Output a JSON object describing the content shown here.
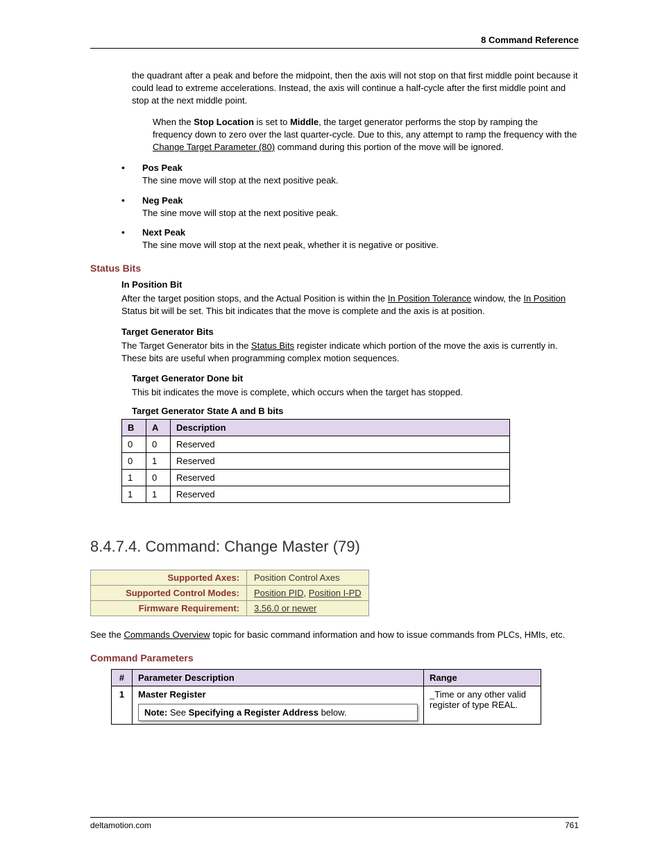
{
  "header": {
    "title": "8  Command Reference"
  },
  "intro_para": "the quadrant after a peak and before the midpoint, then the axis will not stop on that first middle point because it could lead to extreme accelerations. Instead, the axis will continue a half-cycle after the first middle point and stop at the next middle point.",
  "indented": {
    "prefix": "When the ",
    "bold1": "Stop Location",
    "mid1": " is set to ",
    "bold2": "Middle",
    "mid2": ", the target generator performs the stop by ramping the frequency down to zero over the last quarter-cycle. Due to this, any attempt to ramp the frequency with the ",
    "link": "Change Target Parameter (80)",
    "suffix": " command during this portion of the move will be ignored."
  },
  "bullets": [
    {
      "title": "Pos Peak",
      "text": "The sine move will stop at the next positive peak."
    },
    {
      "title": "Neg Peak",
      "text": "The sine move will stop at the next positive peak."
    },
    {
      "title": "Next Peak",
      "text": "The sine move will stop at the next peak, whether it is negative or positive."
    }
  ],
  "status_heading": "Status Bits",
  "in_position": {
    "title": "In Position Bit",
    "p1a": "After the target position stops, and the Actual Position is within the ",
    "link1": "In Position Tolerance",
    "p1b": " window, the ",
    "link2": "In Position",
    "p1c": " Status bit will be set. This bit indicates that the move is complete and the axis is at position."
  },
  "tg_bits": {
    "title": "Target Generator Bits",
    "p_a": "The Target Generator bits in the ",
    "link": "Status Bits",
    "p_b": " register indicate which portion of the move the axis is currently in. These bits are useful when programming complex motion sequences."
  },
  "tg_done": {
    "title": "Target Generator Done bit",
    "text": "This bit indicates the move is complete, which occurs when the target has stopped."
  },
  "tg_state": {
    "title": "Target Generator State A and B bits",
    "headers": [
      "B",
      "A",
      "Description"
    ],
    "rows": [
      [
        "0",
        "0",
        "Reserved"
      ],
      [
        "0",
        "1",
        "Reserved"
      ],
      [
        "1",
        "0",
        "Reserved"
      ],
      [
        "1",
        "1",
        "Reserved"
      ]
    ]
  },
  "section_heading": "8.4.7.4. Command: Change Master (79)",
  "support": {
    "rows": [
      {
        "label": "Supported Axes:",
        "value": "Position Control Axes",
        "linked": false
      },
      {
        "label": "Supported Control Modes:",
        "link1": "Position PID",
        "sep": ", ",
        "link2": "Position I-PD",
        "linked": true
      },
      {
        "label": "Firmware Requirement:",
        "value": "3.56.0 or newer",
        "linked_single": true
      }
    ]
  },
  "overview": {
    "p_a": "See the ",
    "link": "Commands Overview",
    "p_b": " topic for basic command information and how to issue commands from PLCs, HMIs, etc."
  },
  "cmd_params_heading": "Command Parameters",
  "param_table": {
    "headers": [
      "#",
      "Parameter Description",
      "Range"
    ],
    "row": {
      "num": "1",
      "desc_title": "Master Register",
      "note_prefix": "Note: ",
      "note_mid": "See ",
      "note_bold": "Specifying a Register Address",
      "note_suffix": " below.",
      "range": "_Time or any other valid register of type REAL."
    }
  },
  "footer": {
    "left": "deltamotion.com",
    "right": "761"
  }
}
